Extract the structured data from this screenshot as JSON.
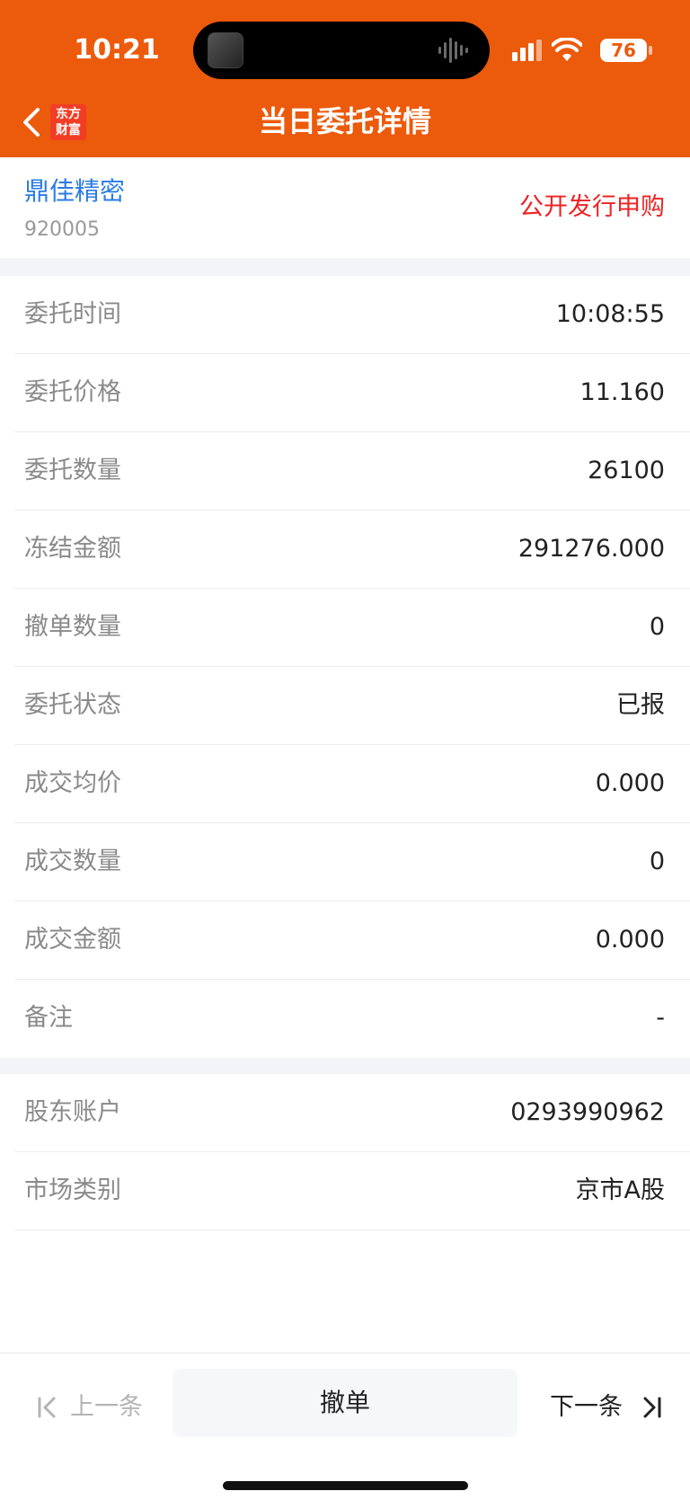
{
  "status_bar": {
    "time": "10:21",
    "battery": "76"
  },
  "nav": {
    "logo_line1": "东方",
    "logo_line2": "财富",
    "title": "当日委托详情"
  },
  "stock": {
    "name": "鼎佳精密",
    "code": "920005",
    "order_type": "公开发行申购"
  },
  "details": [
    {
      "label": "委托时间",
      "value": "10:08:55"
    },
    {
      "label": "委托价格",
      "value": "11.160"
    },
    {
      "label": "委托数量",
      "value": "26100"
    },
    {
      "label": "冻结金额",
      "value": "291276.000"
    },
    {
      "label": "撤单数量",
      "value": "0"
    },
    {
      "label": "委托状态",
      "value": "已报"
    },
    {
      "label": "成交均价",
      "value": "0.000"
    },
    {
      "label": "成交数量",
      "value": "0"
    },
    {
      "label": "成交金额",
      "value": "0.000"
    },
    {
      "label": "备注",
      "value": "-"
    }
  ],
  "account": [
    {
      "label": "股东账户",
      "value": "0293990962"
    },
    {
      "label": "市场类别",
      "value": "京市A股"
    }
  ],
  "footer": {
    "prev_label": "上一条",
    "cancel_label": "撤单",
    "next_label": "下一条"
  },
  "colors": {
    "brand": "#ec5a0b",
    "link_blue": "#2a7be4",
    "alert_red": "#ee2222"
  }
}
